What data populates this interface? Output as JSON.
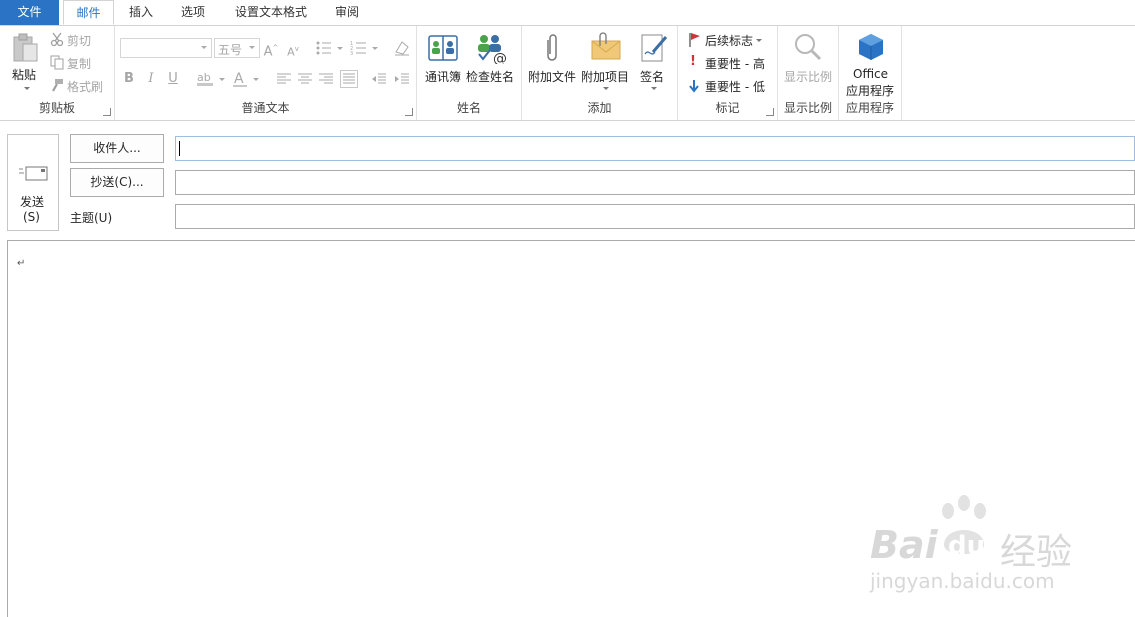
{
  "tabs": [
    "文件",
    "邮件",
    "插入",
    "选项",
    "设置文本格式",
    "审阅"
  ],
  "clipboard": {
    "paste": "粘贴",
    "cut": "剪切",
    "copy": "复制",
    "format_painter": "格式刷",
    "group_label": "剪贴板"
  },
  "basic_text": {
    "font_name": "",
    "font_size": "五号",
    "group_label": "普通文本"
  },
  "names": {
    "address_book": "通讯簿",
    "check_names": "检查姓名",
    "group_label": "姓名"
  },
  "include": {
    "attach_file": "附加文件",
    "attach_item": "附加项目",
    "signature": "签名",
    "group_label": "添加"
  },
  "tags": {
    "follow_up": "后续标志",
    "high": "重要性 - 高",
    "low": "重要性 - 低",
    "group_label": "标记"
  },
  "zoom": {
    "label": "显示比例",
    "group_label": "显示比例"
  },
  "apps": {
    "line1": "Office",
    "line2": "应用程序",
    "group_label": "应用程序"
  },
  "compose": {
    "send_line1": "发送",
    "send_line2": "(S)",
    "to_button": "收件人...",
    "cc_button": "抄送(C)...",
    "subject_label": "主题(U)",
    "to_value": "",
    "cc_value": "",
    "subject_value": "",
    "body_mark": "↵"
  },
  "watermark": {
    "brand": "Bai",
    "brand2": "du",
    "cn": "经验",
    "url": "jingyan.baidu.com"
  },
  "colors": {
    "accent": "#2b74c5",
    "flag": "#d13438",
    "importance_high": "#d13438",
    "importance_low": "#2b74c5"
  }
}
